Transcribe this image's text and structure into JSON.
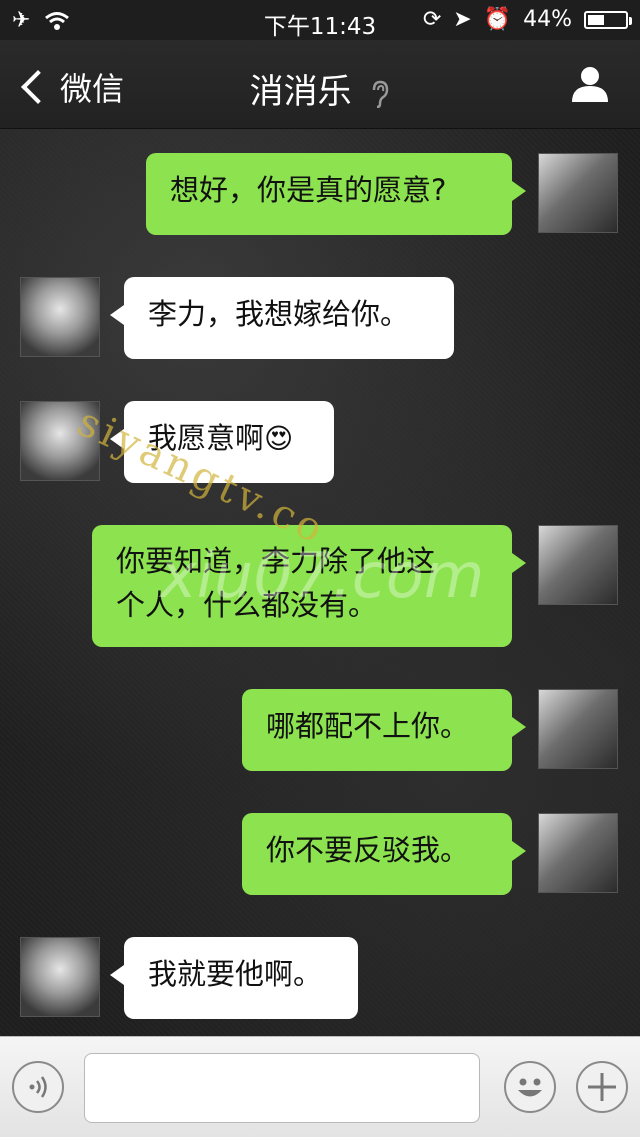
{
  "status_bar": {
    "time": "下午11:43",
    "battery": "44%",
    "battery_level": 0.44
  },
  "nav": {
    "back_label": "微信",
    "title": "消消乐"
  },
  "messages": [
    {
      "from": "me",
      "text": "想好，你是真的愿意?"
    },
    {
      "from": "other",
      "text": "李力，我想嫁给你。"
    },
    {
      "from": "other",
      "text": "我愿意啊",
      "emoji": "😍"
    },
    {
      "from": "me",
      "lines": [
        "你要知道，李力除了他这",
        "个人，什么都没有。"
      ]
    },
    {
      "from": "me",
      "text": "哪都配不上你。"
    },
    {
      "from": "me",
      "text": "你不要反驳我。"
    },
    {
      "from": "other",
      "text": "我就要他啊。"
    }
  ],
  "watermarks": [
    "siyangtv.co",
    "xiu07.com"
  ],
  "input": {
    "value": "",
    "placeholder": ""
  },
  "icons": {
    "voice": "voice-icon",
    "emoji": "emoji-icon",
    "plus": "plus-icon",
    "profile": "profile-icon",
    "ear": "ear-icon"
  },
  "colors": {
    "my_bubble": "#8ce34f",
    "other_bubble": "#ffffff",
    "nav_background": "#222222"
  }
}
